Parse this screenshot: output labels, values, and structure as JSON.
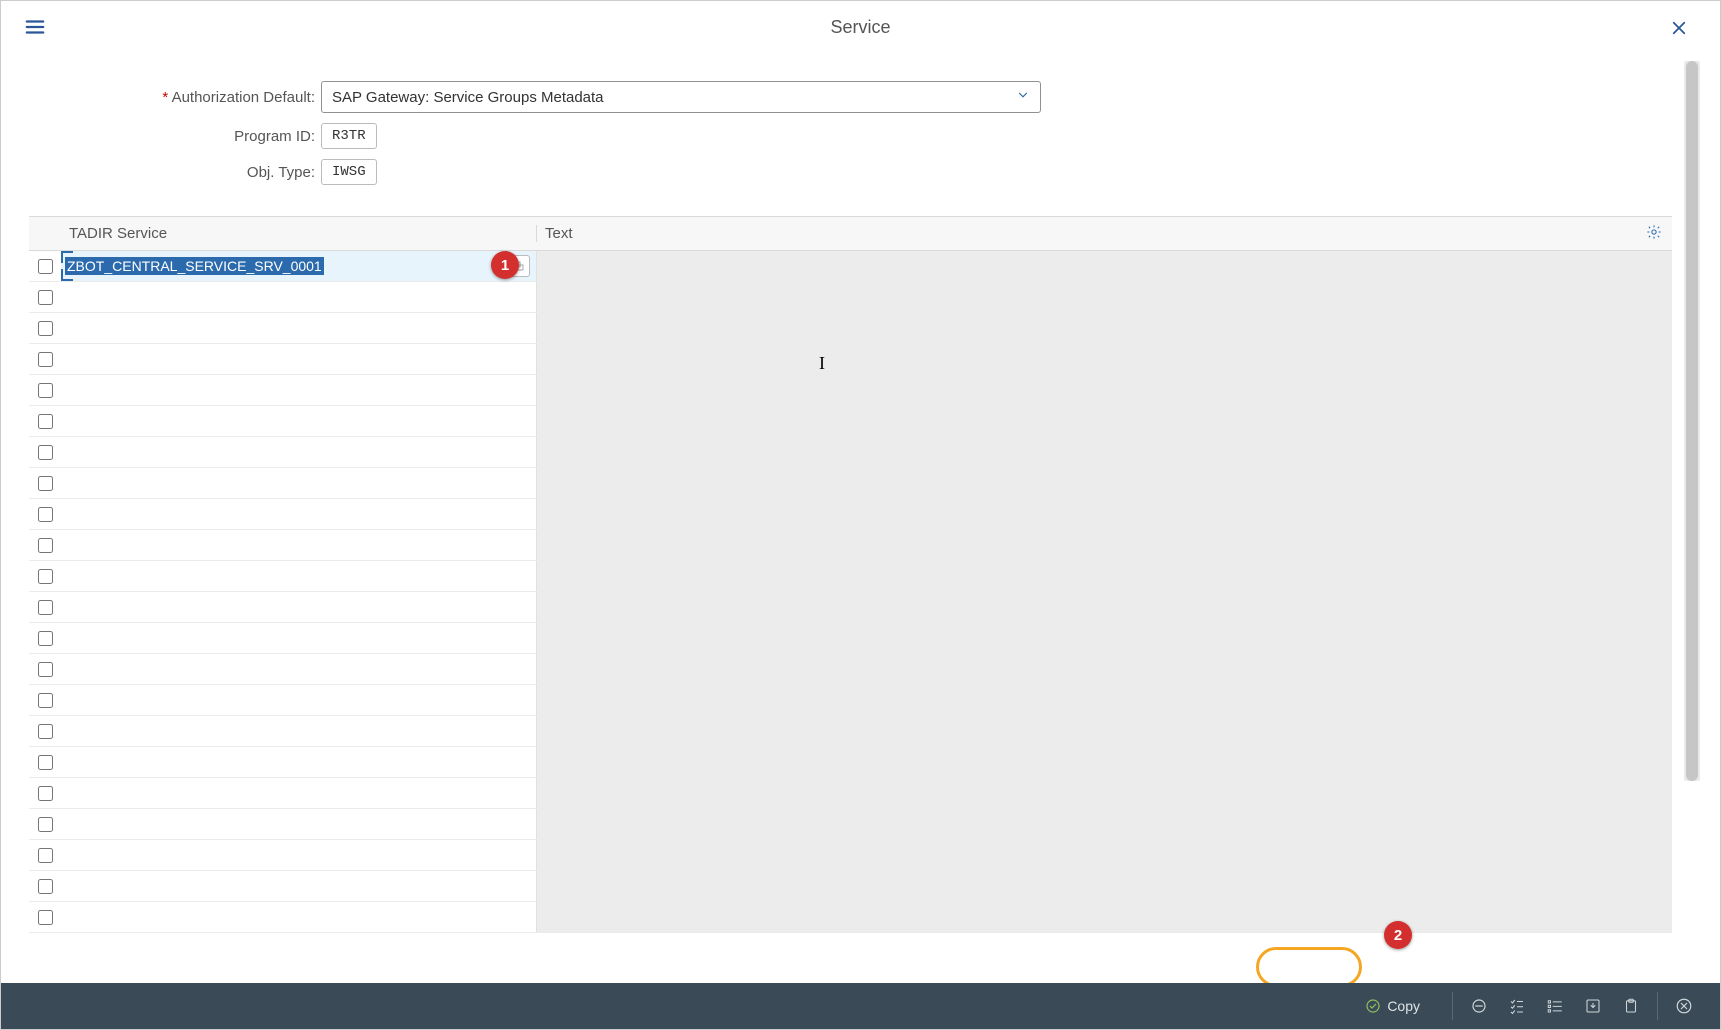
{
  "header": {
    "title": "Service"
  },
  "form": {
    "auth_label": "Authorization Default:",
    "auth_required": "*",
    "auth_value": "SAP Gateway: Service Groups Metadata",
    "program_label": "Program ID:",
    "program_value": "R3TR",
    "objtype_label": "Obj. Type:",
    "objtype_value": "IWSG"
  },
  "table": {
    "col_service": "TADIR Service",
    "col_text": "Text",
    "row0_service": "ZBOT_CENTRAL_SERVICE_SRV_0001",
    "empty_row_count": 21
  },
  "footer": {
    "copy_label": "Copy"
  },
  "annotations": {
    "badge1": "1",
    "badge2": "2"
  },
  "colors": {
    "brand_blue": "#2b6bad",
    "footer_bg": "#3a4a56",
    "annotation_red": "#d32f2f",
    "highlight_orange": "#f5a623"
  }
}
